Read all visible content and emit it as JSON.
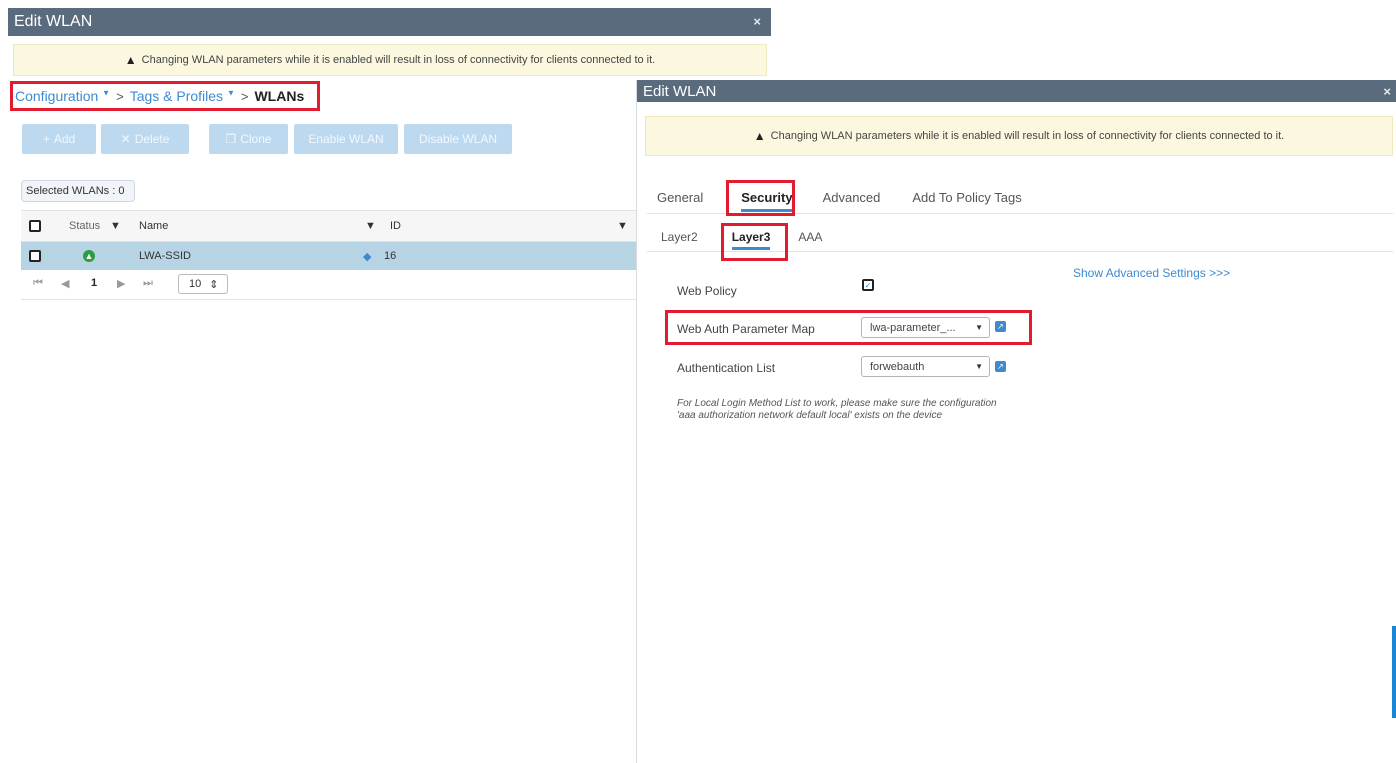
{
  "back_window": {
    "title": "Edit WLAN",
    "close": "×",
    "warning": "Changing WLAN parameters while it is enabled will result in loss of connectivity for clients connected to it.",
    "warning_icon": "▲",
    "breadcrumb": {
      "items": [
        "Configuration",
        "Tags & Profiles"
      ],
      "current": "WLANs",
      "separator": ">"
    },
    "toolbar": {
      "add": "Add",
      "delete": "Delete",
      "clone": "Clone",
      "enable": "Enable WLAN",
      "disable": "Disable WLAN"
    },
    "selected_count": "Selected WLANs : 0",
    "table": {
      "columns": [
        "Status",
        "Name",
        "ID"
      ],
      "rows": [
        {
          "name": "LWA-SSID",
          "id": "16",
          "status": "up"
        }
      ]
    },
    "pager": {
      "page": "1",
      "page_size": "10"
    }
  },
  "front_window": {
    "title": "Edit WLAN",
    "close": "×",
    "warning": "Changing WLAN parameters while it is enabled will result in loss of connectivity for clients connected to it.",
    "tabs": [
      "General",
      "Security",
      "Advanced",
      "Add To Policy Tags"
    ],
    "active_tab": "Security",
    "subtabs": [
      "Layer2",
      "Layer3",
      "AAA"
    ],
    "active_subtab": "Layer3",
    "show_advanced": "Show Advanced Settings >>>",
    "fields": {
      "web_policy_label": "Web Policy",
      "web_policy_checked": true,
      "param_map_label": "Web Auth Parameter Map",
      "param_map_value": "lwa-parameter_...",
      "auth_list_label": "Authentication List",
      "auth_list_value": "forwebauth"
    },
    "note": "For Local Login Method List to work, please make sure the configuration 'aaa authorization network default local' exists on the device"
  },
  "colors": {
    "titlebar": "#5a6b7d",
    "highlight_box": "#e21b2f",
    "accent": "#3d8ad1",
    "selected_row": "#b6d4e4",
    "disabled_button": "#bcd9f0",
    "warning_bg": "#fcf8e0"
  }
}
